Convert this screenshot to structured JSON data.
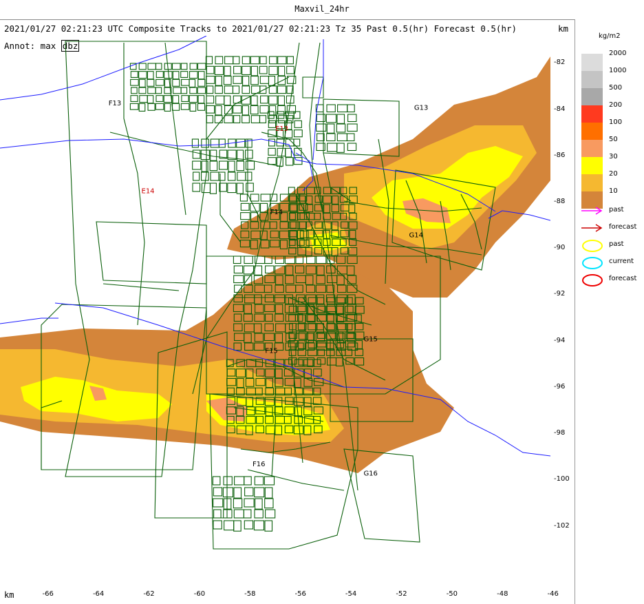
{
  "window_title": "Maxvil_24hr",
  "header": {
    "line": "2021/01/27 02:21:23 UTC Composite Tracks to 2021/01/27 02:21:23 Tz 35 Past 0.5(hr) Forecast 0.5(hr)",
    "units": "km",
    "annot_label": "Annot: max",
    "annot_value": "dbz"
  },
  "legend": {
    "title": "kg/m2",
    "levels": [
      {
        "label": "2000",
        "color": "#dcdcdc"
      },
      {
        "label": "1000",
        "color": "#c4c4c4"
      },
      {
        "label": "500",
        "color": "#a8a8a8"
      },
      {
        "label": "200",
        "color": "#ff3a1f"
      },
      {
        "label": "100",
        "color": "#ff6f00"
      },
      {
        "label": "50",
        "color": "#f89a60"
      },
      {
        "label": "30",
        "color": "#ffff00"
      },
      {
        "label": "20",
        "color": "#f5b830"
      },
      {
        "label": "10",
        "color": "#d4853a"
      }
    ],
    "symbols": [
      {
        "label": "past",
        "kind": "arrow",
        "color": "#ff00ff"
      },
      {
        "label": "forecast",
        "kind": "arrow",
        "color": "#cc0000"
      },
      {
        "label": "past",
        "kind": "ellipse",
        "color": "#ffff00"
      },
      {
        "label": "current",
        "kind": "ellipse",
        "color": "#00e5ff"
      },
      {
        "label": "forecast",
        "kind": "ellipse",
        "color": "#ee0000"
      }
    ]
  },
  "axes": {
    "x_label": "km",
    "x_ticks": [
      "-66",
      "-64",
      "-62",
      "-60",
      "-58",
      "-56",
      "-54",
      "-52",
      "-50",
      "-48",
      "-46"
    ],
    "x_values": [
      -66,
      -64,
      -62,
      -60,
      -58,
      -56,
      -54,
      -52,
      -50,
      -48,
      -46
    ],
    "y_ticks": [
      "-82",
      "-84",
      "-86",
      "-88",
      "-90",
      "-92",
      "-94",
      "-96",
      "-98",
      "-100",
      "-102"
    ],
    "y_values": [
      -82,
      -84,
      -86,
      -88,
      -90,
      -92,
      -94,
      -96,
      -98,
      -100,
      -102
    ],
    "x_range": [
      -67.9,
      -46.1
    ],
    "y_range": [
      -80.8,
      -104.6
    ]
  },
  "labels": [
    {
      "text": "F13",
      "x": -63.6,
      "y": -83.8,
      "color": "#000"
    },
    {
      "text": "E13",
      "x": -57.0,
      "y": -84.9,
      "color": "#cc0000"
    },
    {
      "text": "G13",
      "x": -51.5,
      "y": -84.0,
      "color": "#000"
    },
    {
      "text": "E14",
      "x": -62.3,
      "y": -87.6,
      "color": "#cc0000"
    },
    {
      "text": "F14",
      "x": -57.2,
      "y": -88.5,
      "color": "#000"
    },
    {
      "text": "G14",
      "x": -51.7,
      "y": -89.5,
      "color": "#000"
    },
    {
      "text": "F15",
      "x": -57.4,
      "y": -94.5,
      "color": "#000"
    },
    {
      "text": "G15",
      "x": -53.5,
      "y": -94.0,
      "color": "#000"
    },
    {
      "text": "F16",
      "x": -57.9,
      "y": -99.4,
      "color": "#000"
    },
    {
      "text": "G16",
      "x": -53.5,
      "y": -99.8,
      "color": "#000"
    }
  ]
}
